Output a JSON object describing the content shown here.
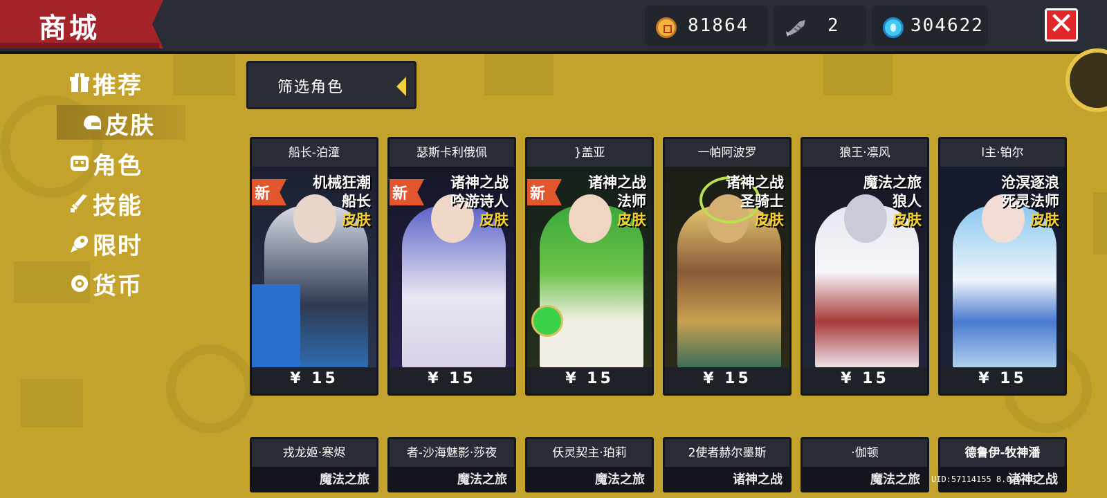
{
  "header": {
    "title": "商城",
    "gold": "81864",
    "fish": "2",
    "gems": "304622",
    "close_label": "✕"
  },
  "sidebar": {
    "items": [
      {
        "label": "推荐",
        "icon": "gift-icon"
      },
      {
        "label": "皮肤",
        "icon": "helmet-icon"
      },
      {
        "label": "角色",
        "icon": "character-face-icon"
      },
      {
        "label": "技能",
        "icon": "skill-sword-icon"
      },
      {
        "label": "限时",
        "icon": "limited-rocket-icon"
      },
      {
        "label": "货币",
        "icon": "currency-coin-icon"
      }
    ],
    "active_index": 1
  },
  "filter": {
    "label": "筛选角色"
  },
  "cards": [
    {
      "name": "船长-泊潼",
      "new": "新",
      "tag1": "机械狂潮",
      "tag2": "船长",
      "tag3": "皮肤",
      "price": "¥ 15"
    },
    {
      "name": "瑟斯卡利俄佩",
      "new": "新",
      "tag1": "诸神之战",
      "tag2": "吟游诗人",
      "tag3": "皮肤",
      "price": "¥ 15"
    },
    {
      "name": "}盖亚",
      "new": "新",
      "tag1": "诸神之战",
      "tag2": "法师",
      "tag3": "皮肤",
      "price": "¥ 15"
    },
    {
      "name": "一帕阿波罗",
      "new": "",
      "tag1": "诸神之战",
      "tag2": "圣骑士",
      "tag3": "皮肤",
      "price": "¥ 15"
    },
    {
      "name": "狼王·凛风",
      "new": "",
      "tag1": "魔法之旅",
      "tag2": "狼人",
      "tag3": "皮肤",
      "price": "¥ 15"
    },
    {
      "name": "l主·铂尔",
      "new": "",
      "tag1": "沧溟逐浪",
      "tag2": "死灵法师",
      "tag3": "皮肤",
      "price": "¥ 15"
    }
  ],
  "cards_row2": [
    {
      "name": "戎龙姬·寒烬",
      "peek": "魔法之旅"
    },
    {
      "name": "者-沙海魅影·莎夜",
      "peek": "魔法之旅"
    },
    {
      "name": "仸灵契主·珀莉",
      "peek": "魔法之旅"
    },
    {
      "name": "2使者赫尔墨斯",
      "peek": "诸神之战"
    },
    {
      "name": "·伽顿",
      "peek": "魔法之旅"
    },
    {
      "name": "德鲁伊-牧神潘",
      "peek": "诸神之战"
    }
  ],
  "uid": "UID:57114155 8.0.0.13",
  "colors": {
    "background": "#c4a32c",
    "topbar": "#2b2d36",
    "title_banner": "#a5242a",
    "close_button": "#e2272a",
    "new_badge": "#e2562e",
    "skin_tag": "#f5d02c"
  }
}
